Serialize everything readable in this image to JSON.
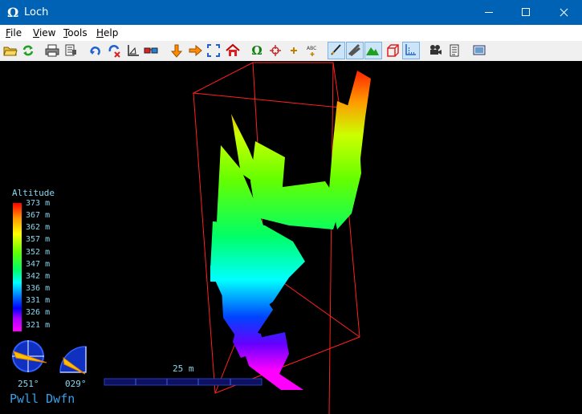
{
  "window": {
    "title": "Loch",
    "app_icon_glyph": "Ω",
    "controls": [
      "minimize",
      "maximize",
      "close"
    ]
  },
  "menu": {
    "file": "File",
    "view": "View",
    "tools": "Tools",
    "help": "Help"
  },
  "toolbar": {
    "buttons": [
      {
        "name": "open-file-button",
        "icon": "folder-open-icon",
        "pressed": false
      },
      {
        "name": "reload-button",
        "icon": "refresh-icon",
        "pressed": false
      },
      {
        "name": "print-button",
        "icon": "printer-icon",
        "pressed": false
      },
      {
        "name": "export-button",
        "icon": "export-icon",
        "pressed": false
      },
      {
        "name": "rotate-button",
        "icon": "rotate-icon",
        "pressed": false
      },
      {
        "name": "reverse-rotation-button",
        "icon": "reverse-icon",
        "pressed": false
      },
      {
        "name": "elevation-button",
        "icon": "elevation-icon",
        "pressed": false
      },
      {
        "name": "stereo-button",
        "icon": "stereo-glasses-icon",
        "pressed": false
      },
      {
        "name": "move-down-button",
        "icon": "arrow-down-icon",
        "pressed": false
      },
      {
        "name": "move-right-button",
        "icon": "arrow-right-icon",
        "pressed": false
      },
      {
        "name": "zoom-extents-button",
        "icon": "fullscreen-icon",
        "pressed": false
      },
      {
        "name": "home-view-button",
        "icon": "home-icon",
        "pressed": false
      },
      {
        "name": "toggle-entrances-button",
        "icon": "omega-icon",
        "pressed": false
      },
      {
        "name": "toggle-fixed-points-button",
        "icon": "crosshair-icon",
        "pressed": false
      },
      {
        "name": "toggle-crosses-button",
        "icon": "plus-icon",
        "pressed": false
      },
      {
        "name": "toggle-labels-button",
        "icon": "labels-icon",
        "pressed": false
      },
      {
        "name": "toggle-centreline-button",
        "icon": "centreline-icon",
        "pressed": true
      },
      {
        "name": "toggle-splays-button",
        "icon": "splays-icon",
        "pressed": true
      },
      {
        "name": "toggle-surface-button",
        "icon": "surface-icon",
        "pressed": true
      },
      {
        "name": "toggle-bounding-box-button",
        "icon": "box-icon",
        "pressed": false
      },
      {
        "name": "toggle-stations-button",
        "icon": "stations-icon",
        "pressed": true
      },
      {
        "name": "presentation-button",
        "icon": "movie-camera-icon",
        "pressed": false
      },
      {
        "name": "notes-button",
        "icon": "notes-icon",
        "pressed": false
      },
      {
        "name": "fullscreen-button",
        "icon": "screen-icon",
        "pressed": false
      }
    ]
  },
  "colors": {
    "titlebar": "#0062b4",
    "legend_text": "#8ad8f0",
    "survey_name": "#39a0e8",
    "box": "#ff2020"
  },
  "legend": {
    "title": "Altitude",
    "labels": [
      "373 m",
      "367 m",
      "362 m",
      "357 m",
      "352 m",
      "347 m",
      "342 m",
      "336 m",
      "331 m",
      "326 m",
      "321 m"
    ]
  },
  "compass": {
    "heading": "251°",
    "tilt": "029°"
  },
  "scale_bar": {
    "label": "25 m"
  },
  "survey_name": "Pwll Dwfn"
}
